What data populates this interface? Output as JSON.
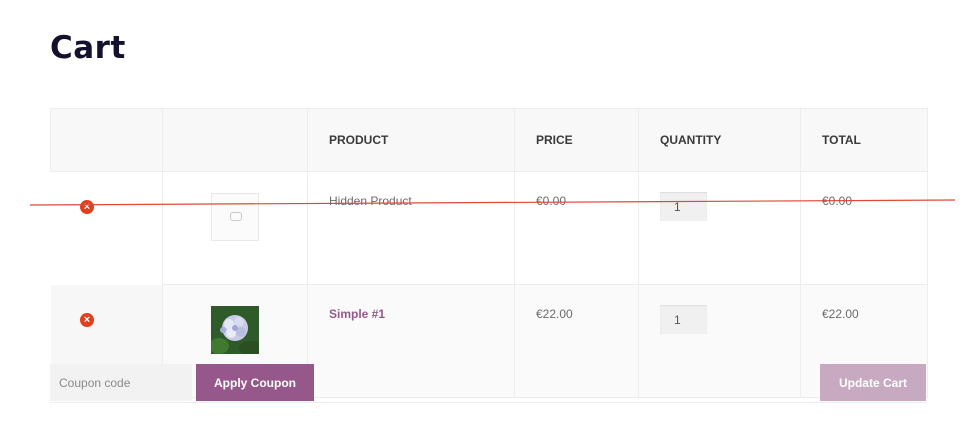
{
  "page": {
    "title": "Cart"
  },
  "table": {
    "headers": {
      "remove": "",
      "thumbnail": "",
      "product": "PRODUCT",
      "price": "PRICE",
      "quantity": "QUANTITY",
      "total": "TOTAL"
    },
    "rows": [
      {
        "product": "Hidden Product",
        "price": "€0.00",
        "quantity": "1",
        "total": "€0.00",
        "thumbnail_icon": "image-placeholder-icon",
        "remove_icon": "remove-circle-icon"
      },
      {
        "product": "Simple #1",
        "price": "€22.00",
        "quantity": "1",
        "total": "€22.00",
        "thumbnail_icon": "hydrangea-flower-photo",
        "remove_icon": "remove-circle-icon"
      }
    ]
  },
  "actions": {
    "coupon_placeholder": "Coupon code",
    "apply_coupon_label": "Apply Coupon",
    "update_cart_label": "Update Cart"
  },
  "colors": {
    "accent": "#96588a",
    "accent_disabled": "#c7a9c2",
    "remove": "#e2401c",
    "strike_line": "#e0483a",
    "title": "#13112e"
  }
}
